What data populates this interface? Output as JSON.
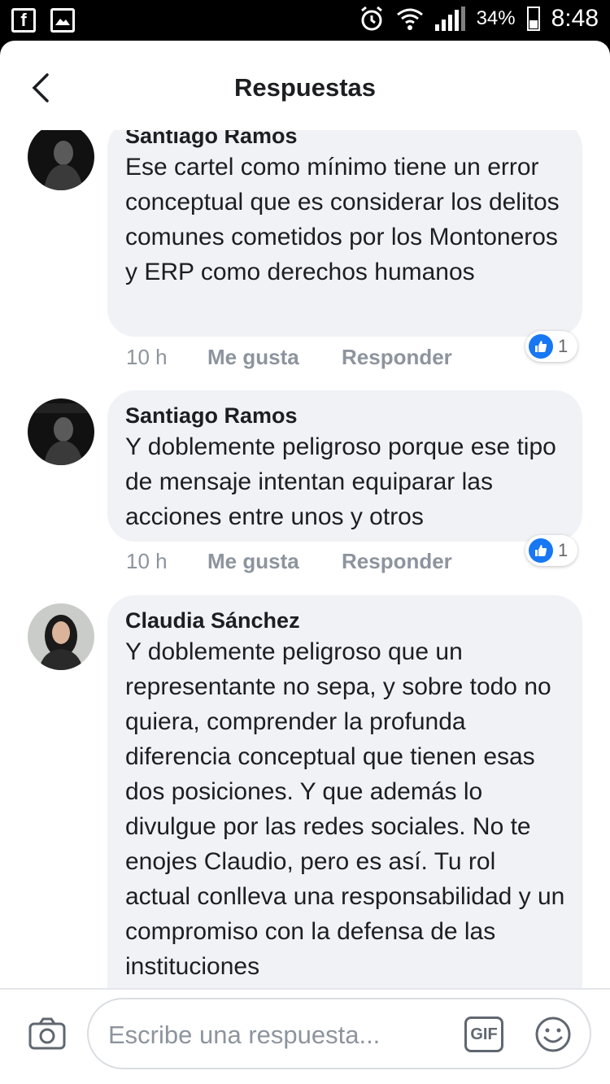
{
  "status_bar": {
    "left_icons": [
      "facebook-icon",
      "image-icon"
    ],
    "battery_percent": "34%",
    "time": "8:48"
  },
  "header": {
    "title": "Respuestas"
  },
  "comments": [
    {
      "author": "Santiago Ramos",
      "text": "Ese cartel como mínimo tiene un error conceptual  que es considerar los delitos comunes cometidos por los Montoneros y ERP como derechos humanos",
      "time": "10 h",
      "like_label": "Me gusta",
      "reply_label": "Responder",
      "reaction_count": "1"
    },
    {
      "author": "Santiago Ramos",
      "text": "Y doblemente peligroso porque ese tipo de mensaje intentan equiparar las acciones entre unos y otros",
      "time": "10 h",
      "like_label": "Me gusta",
      "reply_label": "Responder",
      "reaction_count": "1"
    },
    {
      "author": "Claudia Sánchez",
      "text": "Y doblemente peligroso que un representante no sepa, y sobre todo no quiera, comprender la profunda diferencia conceptual que tienen esas dos posiciones. Y que además lo divulgue por las redes sociales. No te enojes Claudio, pero es así. Tu rol actual conlleva una responsabilidad y un compromiso con la defensa de las instituciones"
    }
  ],
  "composer": {
    "placeholder": "Escribe una respuesta...",
    "gif_label": "GIF"
  },
  "colors": {
    "accent": "#1877f2",
    "bubble": "#f0f2f5",
    "muted_text": "#8d949e"
  }
}
